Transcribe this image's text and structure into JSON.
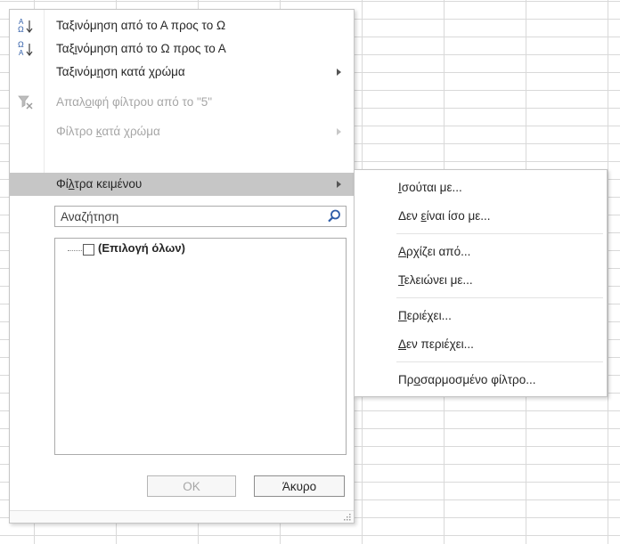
{
  "menu": {
    "sort_az": {
      "pre": "Ταξινόμηση από το Α προς το Ω",
      "icon": "sort-az-icon"
    },
    "sort_za": {
      "p1": "Ταξ",
      "u": "ι",
      "p2": "νόμηση από το Ω προς το Α",
      "icon": "sort-za-icon"
    },
    "sort_color": {
      "p1": "Ταξινόμ",
      "u": "η",
      "p2": "ση κατά χρώμα"
    },
    "clear_filter": {
      "p1": "Απαλ",
      "u": "ο",
      "p2": "ιφή φίλτρου από το \"5\"",
      "icon": "clear-filter-icon"
    },
    "filter_color": {
      "p1": "Φίλτρο ",
      "u": "κ",
      "p2": "ατά χρώμα"
    },
    "text_filters": {
      "p1": "Φί",
      "u": "λ",
      "p2": "τρα κειμένου"
    }
  },
  "search": {
    "placeholder": "Αναζήτηση",
    "icon": "search-icon"
  },
  "list": {
    "select_all": "(Επιλογή όλων)"
  },
  "buttons": {
    "ok": "OK",
    "cancel": "Άκυρο"
  },
  "submenu": {
    "equals": {
      "u": "Ι",
      "p2": "σούται με..."
    },
    "not_equals": {
      "p1": "Δεν ",
      "u": "ε",
      "p2": "ίναι ίσο με..."
    },
    "begins": {
      "u": "Α",
      "p2": "ρχίζει από..."
    },
    "ends": {
      "u": "Τ",
      "p2": "ελειώνει με..."
    },
    "contains": {
      "u": "Π",
      "p2": "εριέχει..."
    },
    "not_contains": {
      "u": "Δ",
      "p2": "εν περιέχει..."
    },
    "custom": {
      "p1": "Πρ",
      "u": "ο",
      "p2": "σαρμοσμένο φίλτρο..."
    }
  },
  "colors": {
    "highlight": "#c6c6c6",
    "disabled": "#a6a6a6",
    "icon_blue": "#2f5da8",
    "text": "#262626"
  }
}
